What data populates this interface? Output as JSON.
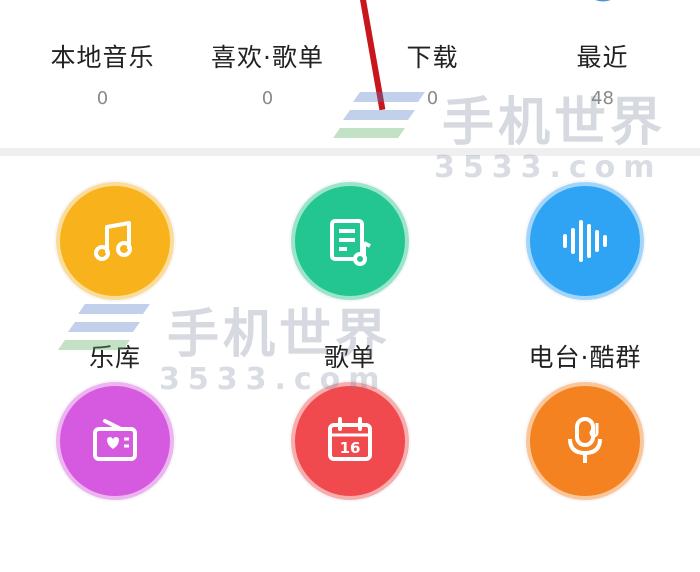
{
  "stats": [
    {
      "label": "本地音乐",
      "count": "0",
      "icon": "music-folder-icon"
    },
    {
      "label": "喜欢·歌单",
      "count": "0",
      "icon": "heart-shield-icon"
    },
    {
      "label": "下载",
      "count": "0",
      "icon": "download-icon"
    },
    {
      "label": "最近",
      "count": "48",
      "icon": "clock-icon"
    }
  ],
  "grid": [
    {
      "label": "乐库",
      "icon": "music-note-icon",
      "color": "#F7B21C"
    },
    {
      "label": "歌单",
      "icon": "playlist-icon",
      "color": "#23C690"
    },
    {
      "label": "电台·酷群",
      "icon": "sound-wave-icon",
      "color": "#2FA4F4"
    },
    {
      "label": "",
      "icon": "radio-icon",
      "color": "#D55ADF"
    },
    {
      "label": "",
      "icon": "calendar-16-icon",
      "color": "#F04A4E",
      "badge": "16"
    },
    {
      "label": "",
      "icon": "microphone-icon",
      "color": "#F58220"
    }
  ],
  "watermark": {
    "title": "手机世界",
    "site": "3533.com"
  }
}
